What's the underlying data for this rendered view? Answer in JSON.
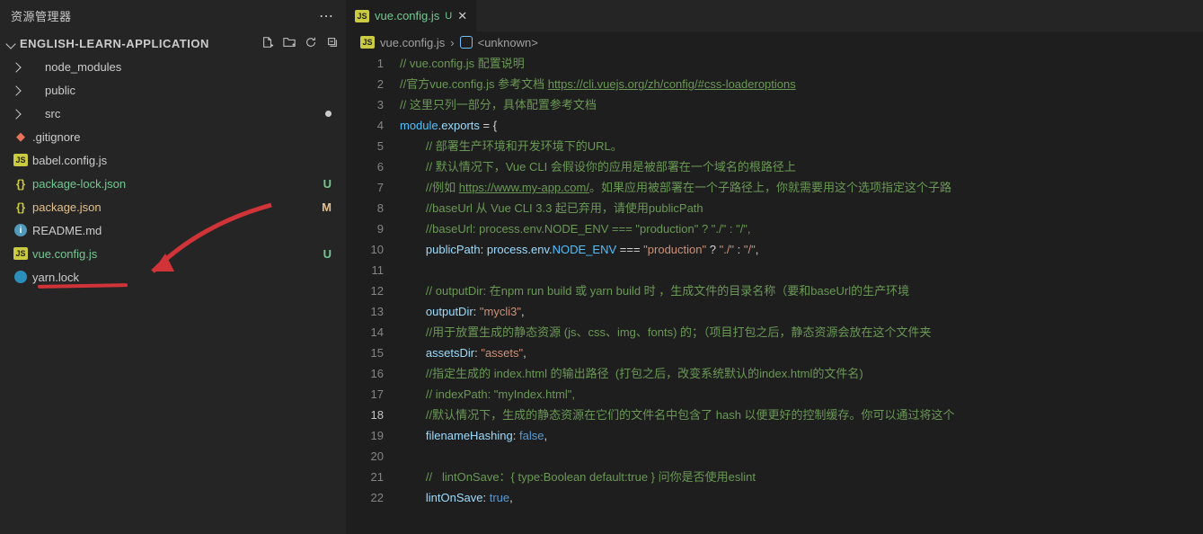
{
  "sidebar": {
    "header_title": "资源管理器",
    "section_title": "ENGLISH-LEARN-APPLICATION",
    "items": [
      {
        "icon": "folder",
        "label": "node_modules",
        "git": "",
        "isFolder": true
      },
      {
        "icon": "folder",
        "label": "public",
        "git": "",
        "isFolder": true
      },
      {
        "icon": "folder",
        "label": "src",
        "git": "dot",
        "isFolder": true
      },
      {
        "icon": "git",
        "label": ".gitignore",
        "git": ""
      },
      {
        "icon": "js",
        "label": "babel.config.js",
        "git": ""
      },
      {
        "icon": "json",
        "label": "package-lock.json",
        "git": "U"
      },
      {
        "icon": "json",
        "label": "package.json",
        "git": "M"
      },
      {
        "icon": "info",
        "label": "README.md",
        "git": ""
      },
      {
        "icon": "js",
        "label": "vue.config.js",
        "git": "U"
      },
      {
        "icon": "yarn",
        "label": "yarn.lock",
        "git": ""
      }
    ]
  },
  "tabs": [
    {
      "icon": "js",
      "label": "vue.config.js",
      "badge": "U"
    }
  ],
  "breadcrumb": {
    "file_icon": "js",
    "file": "vue.config.js",
    "symbol": "<unknown>"
  },
  "editor": {
    "active_line": 18,
    "lines": [
      {
        "n": 1,
        "tokens": [
          [
            "cmt",
            "// vue.config.js 配置说明"
          ]
        ]
      },
      {
        "n": 2,
        "tokens": [
          [
            "cmt",
            "//官方vue.config.js 参考文档 "
          ],
          [
            "link",
            "https://cli.vuejs.org/zh/config/#css-loaderoptions"
          ]
        ]
      },
      {
        "n": 3,
        "tokens": [
          [
            "cmt",
            "// 这里只列一部分，具体配置参考文档"
          ]
        ]
      },
      {
        "n": 4,
        "tokens": [
          [
            "var",
            "module"
          ],
          [
            "punc",
            "."
          ],
          [
            "hl",
            "exports"
          ],
          [
            "op",
            " = "
          ],
          [
            "punc",
            "{"
          ]
        ]
      },
      {
        "n": 5,
        "indent": 2,
        "tokens": [
          [
            "cmt",
            "// 部署生产环境和开发环境下的URL。"
          ]
        ]
      },
      {
        "n": 6,
        "indent": 2,
        "tokens": [
          [
            "cmt",
            "// 默认情况下，Vue CLI 会假设你的应用是被部署在一个域名的根路径上"
          ]
        ]
      },
      {
        "n": 7,
        "indent": 2,
        "tokens": [
          [
            "cmt",
            "//例如 "
          ],
          [
            "link",
            "https://www.my-app.com/"
          ],
          [
            "cmt",
            "。如果应用被部署在一个子路径上，你就需要用这个选项指定这个子路"
          ]
        ]
      },
      {
        "n": 8,
        "indent": 2,
        "tokens": [
          [
            "cmt",
            "//baseUrl 从 Vue CLI 3.3 起已弃用，请使用publicPath"
          ]
        ]
      },
      {
        "n": 9,
        "indent": 2,
        "tokens": [
          [
            "cmt",
            "//baseUrl: process.env.NODE_ENV === \"production\" ? \"./\" : \"/\","
          ]
        ]
      },
      {
        "n": 10,
        "indent": 2,
        "tokens": [
          [
            "prop",
            "publicPath"
          ],
          [
            "op",
            ": "
          ],
          [
            "hl",
            "process"
          ],
          [
            "punc",
            "."
          ],
          [
            "hl",
            "env"
          ],
          [
            "punc",
            "."
          ],
          [
            "var",
            "NODE_ENV"
          ],
          [
            "op",
            " === "
          ],
          [
            "str",
            "\"production\""
          ],
          [
            "op",
            " ? "
          ],
          [
            "str",
            "\"./\""
          ],
          [
            "op",
            " : "
          ],
          [
            "str",
            "\"/\""
          ],
          [
            "punc",
            ","
          ]
        ]
      },
      {
        "n": 11,
        "tokens": []
      },
      {
        "n": 12,
        "indent": 2,
        "tokens": [
          [
            "cmt",
            "// outputDir: 在npm run build 或 yarn build 时 ，生成文件的目录名称（要和baseUrl的生产环境"
          ]
        ]
      },
      {
        "n": 13,
        "indent": 2,
        "tokens": [
          [
            "prop",
            "outputDir"
          ],
          [
            "op",
            ": "
          ],
          [
            "str",
            "\"mycli3\""
          ],
          [
            "punc",
            ","
          ]
        ]
      },
      {
        "n": 14,
        "indent": 2,
        "tokens": [
          [
            "cmt",
            "//用于放置生成的静态资源 (js、css、img、fonts) 的；（项目打包之后，静态资源会放在这个文件夹"
          ]
        ]
      },
      {
        "n": 15,
        "indent": 2,
        "tokens": [
          [
            "prop",
            "assetsDir"
          ],
          [
            "op",
            ": "
          ],
          [
            "str",
            "\"assets\""
          ],
          [
            "punc",
            ","
          ]
        ]
      },
      {
        "n": 16,
        "indent": 2,
        "tokens": [
          [
            "cmt",
            "//指定生成的 index.html 的输出路径  (打包之后，改变系统默认的index.html的文件名)"
          ]
        ]
      },
      {
        "n": 17,
        "indent": 2,
        "tokens": [
          [
            "cmt",
            "// indexPath: \"myIndex.html\","
          ]
        ]
      },
      {
        "n": 18,
        "indent": 2,
        "tokens": [
          [
            "cmt",
            "//默认情况下，生成的静态资源在它们的文件名中包含了 hash 以便更好的控制缓存。你可以通过将这个"
          ]
        ]
      },
      {
        "n": 19,
        "indent": 2,
        "tokens": [
          [
            "prop",
            "filenameHashing"
          ],
          [
            "op",
            ": "
          ],
          [
            "const",
            "false"
          ],
          [
            "punc",
            ","
          ]
        ]
      },
      {
        "n": 20,
        "tokens": []
      },
      {
        "n": 21,
        "indent": 2,
        "tokens": [
          [
            "cmt",
            "//   lintOnSave：{ type:Boolean default:true } 问你是否使用eslint"
          ]
        ]
      },
      {
        "n": 22,
        "indent": 2,
        "tokens": [
          [
            "prop",
            "lintOnSave"
          ],
          [
            "op",
            ": "
          ],
          [
            "const",
            "true"
          ],
          [
            "punc",
            ","
          ]
        ]
      }
    ]
  }
}
